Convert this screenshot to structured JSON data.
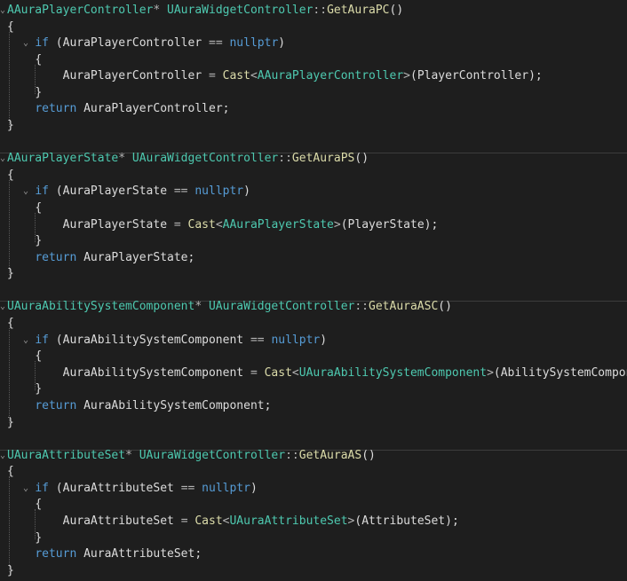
{
  "colors": {
    "background": "#1e1e1e",
    "type": "#4ec9b0",
    "keyword": "#569cd6",
    "function": "#dcdcaa",
    "identifier": "#dcdcdc"
  },
  "blocks": [
    {
      "ret_type": "AAuraPlayerController",
      "class": "UAuraWidgetController",
      "func": "GetAuraPC",
      "member": "AuraPlayerController",
      "cast_type": "AAuraPlayerController",
      "arg": "PlayerController"
    },
    {
      "ret_type": "AAuraPlayerState",
      "class": "UAuraWidgetController",
      "func": "GetAuraPS",
      "member": "AuraPlayerState",
      "cast_type": "AAuraPlayerState",
      "arg": "PlayerState"
    },
    {
      "ret_type": "UAuraAbilitySystemComponent",
      "class": "UAuraWidgetController",
      "func": "GetAuraASC",
      "member": "AuraAbilitySystemComponent",
      "cast_type": "UAuraAbilitySystemComponent",
      "arg": "AbilitySystemComponent"
    },
    {
      "ret_type": "UAuraAttributeSet",
      "class": "UAuraWidgetController",
      "func": "GetAuraAS",
      "member": "AuraAttributeSet",
      "cast_type": "UAuraAttributeSet",
      "arg": "AttributeSet"
    }
  ],
  "tokens": {
    "star": "*",
    "scope": "::",
    "parens": "()",
    "open_brace": "{",
    "close_brace": "}",
    "kw_if": "if",
    "open_paren": "(",
    "close_paren": ")",
    "eqeq": "==",
    "nullptr": "nullptr",
    "assign": "=",
    "cast": "Cast",
    "lt": "<",
    "gt": ">",
    "close_call": ");",
    "kw_return": "return",
    "semicolon": ";",
    "fold_marker": "⌄"
  }
}
